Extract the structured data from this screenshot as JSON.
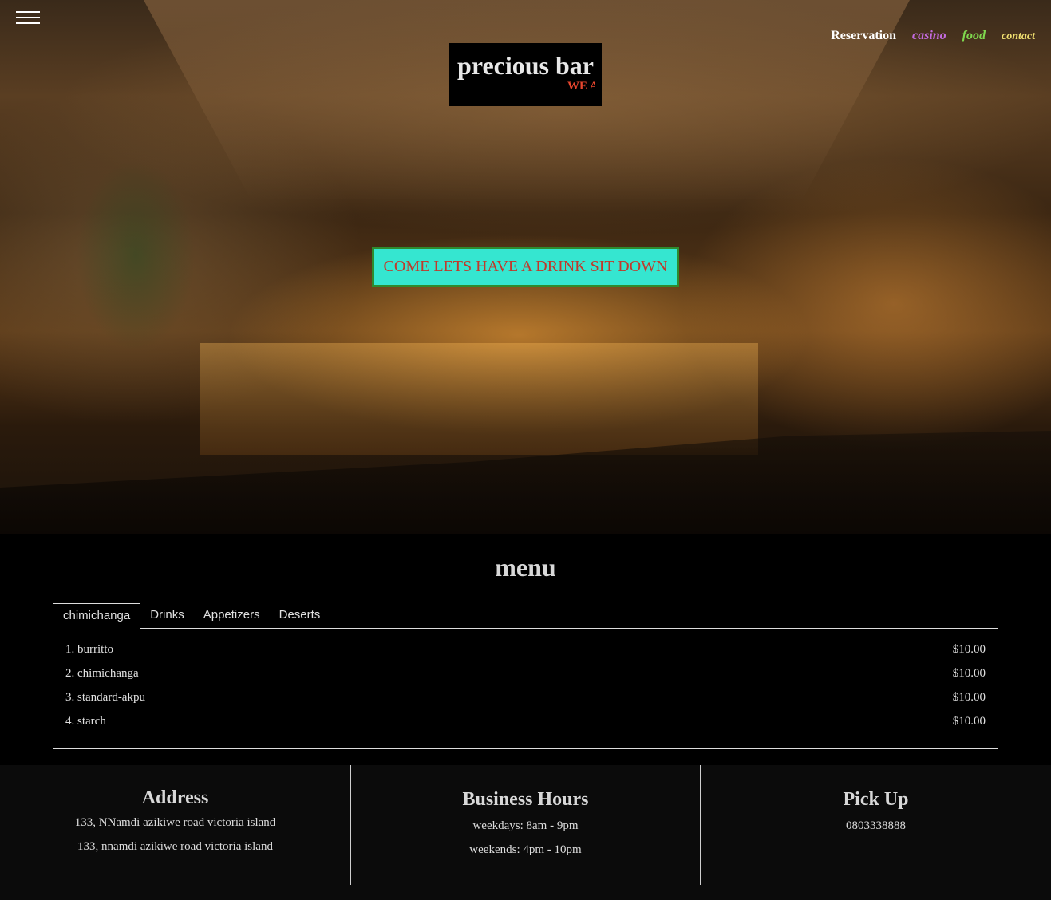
{
  "nav": {
    "items": [
      "Reservation",
      "casino",
      "food",
      "contact"
    ]
  },
  "logo": {
    "title": "precious bar",
    "tagline": "WE A"
  },
  "hero": {
    "cta_label": "COME LETS HAVE A DRINK SIT DOWN"
  },
  "menu": {
    "title": "menu",
    "tabs": [
      "chimichanga",
      "Drinks",
      "Appetizers",
      "Deserts"
    ],
    "active_tab": "chimichanga",
    "items": [
      {
        "name": "1. burritto",
        "price": "$10.00"
      },
      {
        "name": "2. chimichanga",
        "price": "$10.00"
      },
      {
        "name": "3. standard-akpu",
        "price": "$10.00"
      },
      {
        "name": "4. starch",
        "price": "$10.00"
      }
    ]
  },
  "footer": {
    "address": {
      "heading": "Address",
      "lines": [
        "133, NNamdi azikiwe road victoria island",
        "133, nnamdi azikiwe road victoria island"
      ]
    },
    "hours": {
      "heading": "Business Hours",
      "lines": [
        "weekdays: 8am - 9pm",
        "weekends: 4pm - 10pm"
      ]
    },
    "pickup": {
      "heading": "Pick Up",
      "lines": [
        "0803338888"
      ]
    }
  },
  "colors": {
    "cta_bg": "#35e6d0",
    "cta_border": "#2e8b2e",
    "cta_text": "#c0392b",
    "nav_casino": "#c46be0",
    "nav_food": "#7fd84e",
    "nav_contact": "#f0e070",
    "tagline": "#e8462e"
  },
  "icons": {
    "menu_toggle": "hamburger-icon"
  }
}
